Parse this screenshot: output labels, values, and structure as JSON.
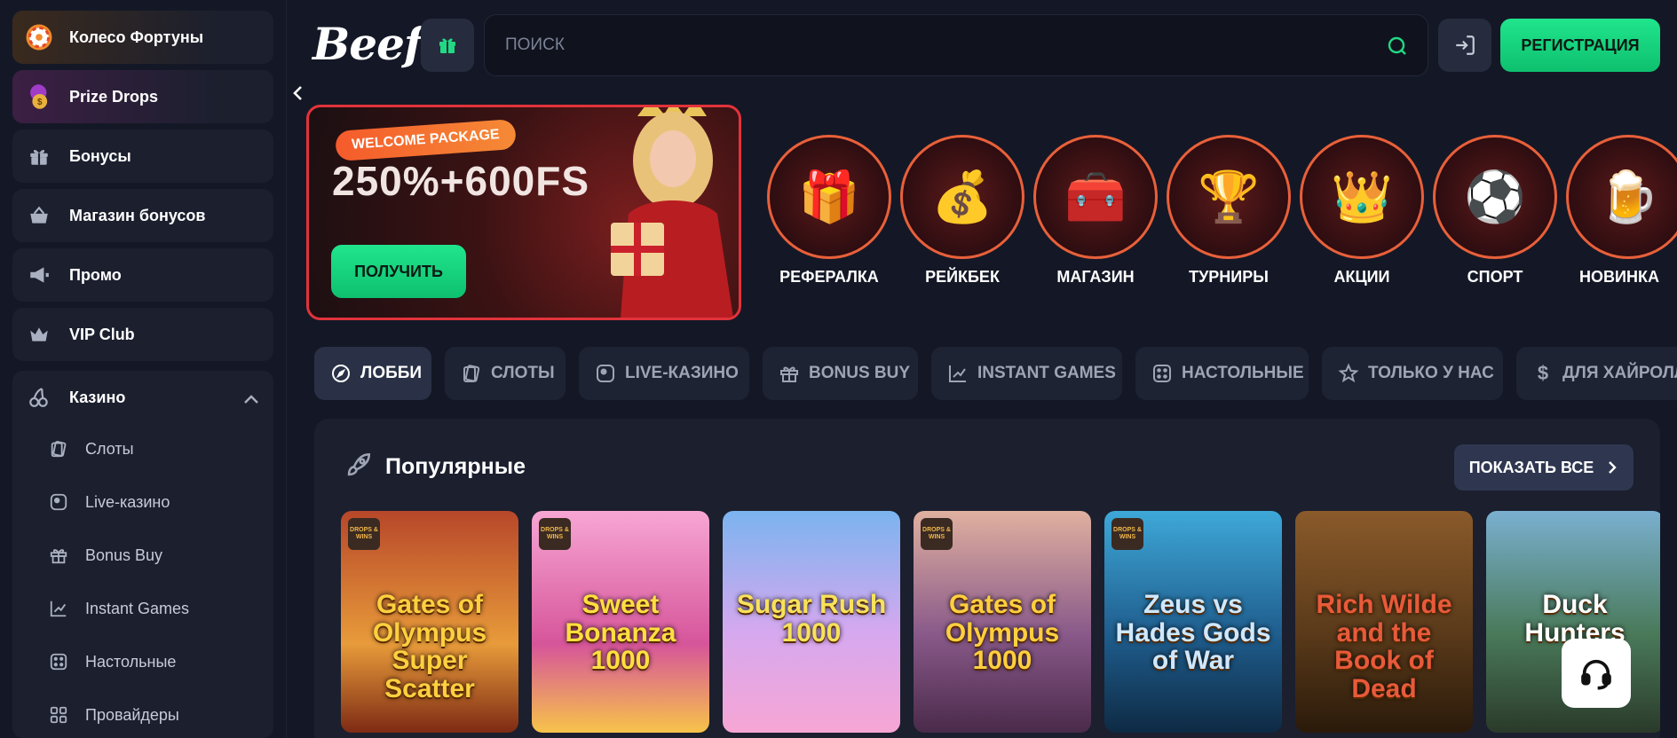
{
  "sidebar": {
    "top_items": [
      {
        "label": "Колесо Фортуны",
        "icon": "fortune-wheel-icon"
      },
      {
        "label": "Prize Drops",
        "icon": "prize-drops-icon"
      },
      {
        "label": "Бонусы",
        "icon": "gift-icon"
      },
      {
        "label": "Магазин бонусов",
        "icon": "shopping-basket-icon"
      },
      {
        "label": "Промо",
        "icon": "megaphone-icon"
      },
      {
        "label": "VIP Club",
        "icon": "crown-icon"
      }
    ],
    "casino": {
      "label": "Казино",
      "icon": "cherries-icon",
      "items": [
        {
          "label": "Слоты",
          "icon": "cards-icon"
        },
        {
          "label": "Live-казино",
          "icon": "live-icon"
        },
        {
          "label": "Bonus Buy",
          "icon": "gift-icon"
        },
        {
          "label": "Instant Games",
          "icon": "chart-icon"
        },
        {
          "label": "Настольные",
          "icon": "dice-icon"
        },
        {
          "label": "Провайдеры",
          "icon": "grid-icon"
        }
      ]
    }
  },
  "header": {
    "logo": "Beef",
    "search_placeholder": "ПОИСК",
    "register_label": "РЕГИСТРАЦИЯ"
  },
  "promo": {
    "tag": "WELCOME PACKAGE",
    "amount": "250%+600FS",
    "button": "ПОЛУЧИТЬ"
  },
  "categories": [
    {
      "label": "РЕФЕРАЛКА",
      "emoji": "🎁"
    },
    {
      "label": "РЕЙКБЕК",
      "emoji": "💰"
    },
    {
      "label": "МАГАЗИН",
      "emoji": "🧰"
    },
    {
      "label": "ТУРНИРЫ",
      "emoji": "🏆"
    },
    {
      "label": "АКЦИИ",
      "emoji": "👑"
    },
    {
      "label": "СПОРТ",
      "emoji": "⚽"
    },
    {
      "label": "НОВИНКА",
      "emoji": "🍺"
    }
  ],
  "tabs": [
    {
      "label": "ЛОББИ",
      "icon": "compass-icon",
      "active": true
    },
    {
      "label": "СЛОТЫ",
      "icon": "cards-icon"
    },
    {
      "label": "LIVE-КАЗИНО",
      "icon": "live-icon"
    },
    {
      "label": "BONUS BUY",
      "icon": "gift-icon"
    },
    {
      "label": "INSTANT GAMES",
      "icon": "chart-icon"
    },
    {
      "label": "НАСТОЛЬНЫЕ",
      "icon": "dice-icon"
    },
    {
      "label": "ТОЛЬКО У НАС",
      "icon": "star-icon"
    },
    {
      "label": "ДЛЯ ХАЙРОЛЛЕРОВ",
      "icon": "dollar-icon"
    }
  ],
  "popular": {
    "title": "Популярные",
    "show_all": "ПОКАЗАТЬ ВСЕ",
    "drops_wins": "DROPS & WINS",
    "games": [
      {
        "title": "Gates of Olympus Super Scatter",
        "bg": "#8a4b1e"
      },
      {
        "title": "Sweet Bonanza 1000",
        "bg": "#d6559a"
      },
      {
        "title": "Sugar Rush 1000",
        "bg": "#7bb4ef"
      },
      {
        "title": "Gates of Olympus 1000",
        "bg": "#6b4a7a"
      },
      {
        "title": "Zeus vs Hades Gods of War",
        "bg": "#1f5e8e"
      },
      {
        "title": "Rich Wilde and the Book of Dead",
        "bg": "#5a3a1a"
      },
      {
        "title": "Duck Hunters",
        "bg": "#2f5a3a"
      }
    ]
  }
}
